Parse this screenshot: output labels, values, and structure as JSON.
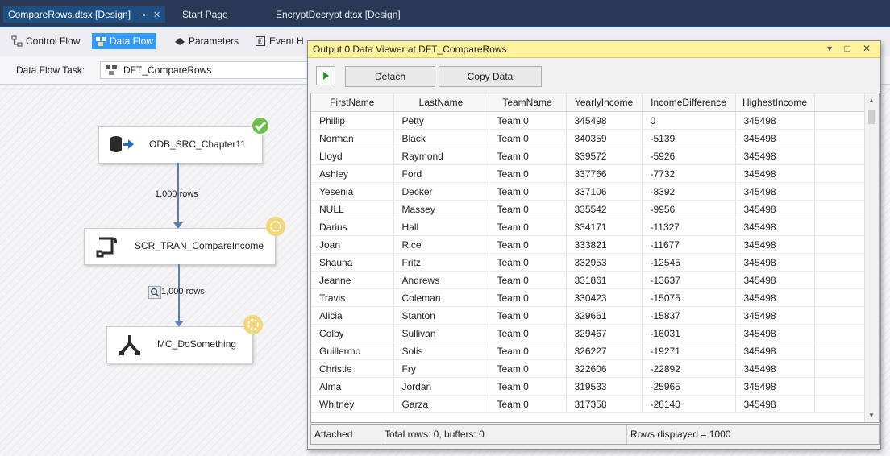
{
  "document_tabs": [
    {
      "label": "CompareRows.dtsx [Design]",
      "active": true
    },
    {
      "label": "Start Page",
      "active": false
    },
    {
      "label": "EncryptDecrypt.dtsx [Design]",
      "active": false
    }
  ],
  "tab_controls": {
    "pin": "⊸",
    "close": "✕"
  },
  "designer_tabs": [
    {
      "label": "Control Flow",
      "icon": "control-flow-icon",
      "selected": false
    },
    {
      "label": "Data Flow",
      "icon": "data-flow-icon",
      "selected": true
    },
    {
      "label": "Parameters",
      "icon": "parameters-icon",
      "selected": false
    },
    {
      "label": "Event H",
      "icon": "event-handlers-icon",
      "selected": false
    }
  ],
  "task_row": {
    "label": "Data Flow Task:",
    "value": "DFT_CompareRows"
  },
  "components": {
    "source": {
      "label": "ODB_SRC_Chapter11",
      "icon": "database-source-icon",
      "status": "success-check-icon"
    },
    "script": {
      "label": "SCR_TRAN_CompareIncome",
      "icon": "script-component-icon",
      "status": "running-icon"
    },
    "multicast": {
      "label": "MC_DoSomething",
      "icon": "multicast-icon",
      "status": "running-icon"
    }
  },
  "paths": {
    "first": {
      "rows": "1,000 rows"
    },
    "second": {
      "rows": "1,000 rows",
      "icon": "data-viewer-icon"
    }
  },
  "viewer": {
    "title": "Output 0 Data Viewer at DFT_CompareRows",
    "window_buttons": "▾ □ ✕",
    "detach_label": "Detach",
    "copy_label": "Copy Data",
    "columns": [
      "FirstName",
      "LastName",
      "TeamName",
      "YearlyIncome",
      "IncomeDifference",
      "HighestIncome"
    ],
    "rows": [
      [
        "Phillip",
        "Petty",
        "Team 0",
        "345498",
        "0",
        "345498"
      ],
      [
        "Norman",
        "Black",
        "Team 0",
        "340359",
        "-5139",
        "345498"
      ],
      [
        "Lloyd",
        "Raymond",
        "Team 0",
        "339572",
        "-5926",
        "345498"
      ],
      [
        "Ashley",
        "Ford",
        "Team 0",
        "337766",
        "-7732",
        "345498"
      ],
      [
        "Yesenia",
        "Decker",
        "Team 0",
        "337106",
        "-8392",
        "345498"
      ],
      [
        "NULL",
        "Massey",
        "Team 0",
        "335542",
        "-9956",
        "345498"
      ],
      [
        "Darius",
        "Hall",
        "Team 0",
        "334171",
        "-11327",
        "345498"
      ],
      [
        "Joan",
        "Rice",
        "Team 0",
        "333821",
        "-11677",
        "345498"
      ],
      [
        "Shauna",
        "Fritz",
        "Team 0",
        "332953",
        "-12545",
        "345498"
      ],
      [
        "Jeanne",
        "Andrews",
        "Team 0",
        "331861",
        "-13637",
        "345498"
      ],
      [
        "Travis",
        "Coleman",
        "Team 0",
        "330423",
        "-15075",
        "345498"
      ],
      [
        "Alicia",
        "Stanton",
        "Team 0",
        "329661",
        "-15837",
        "345498"
      ],
      [
        "Colby",
        "Sullivan",
        "Team 0",
        "329467",
        "-16031",
        "345498"
      ],
      [
        "Guillermo",
        "Solis",
        "Team 0",
        "326227",
        "-19271",
        "345498"
      ],
      [
        "Christie",
        "Fry",
        "Team 0",
        "322606",
        "-22892",
        "345498"
      ],
      [
        "Alma",
        "Jordan",
        "Team 0",
        "319533",
        "-25965",
        "345498"
      ],
      [
        "Whitney",
        "Garza",
        "Team 0",
        "317358",
        "-28140",
        "345498"
      ]
    ],
    "status": {
      "state": "Attached",
      "totals": "Total rows: 0, buffers: 0",
      "displayed": "Rows displayed = 1000"
    }
  },
  "colors": {
    "tab_strip": "#293955",
    "selected_tab": "#3399ff",
    "viewer_title": "#fff29d",
    "path_arrow": "#5b7fb3"
  }
}
